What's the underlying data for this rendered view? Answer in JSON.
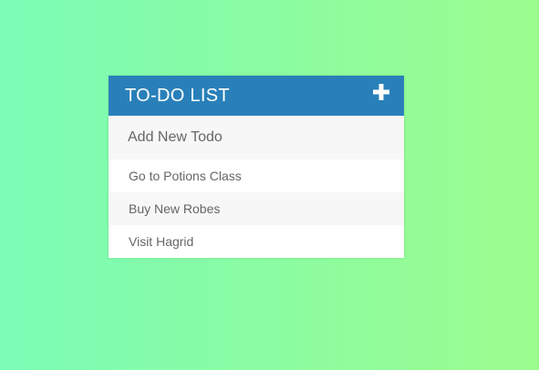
{
  "todo": {
    "title": "TO-DO LIST",
    "add_icon": "plus-icon",
    "input": {
      "placeholder": "Add New Todo",
      "value": ""
    },
    "items": [
      {
        "label": "Go to Potions Class"
      },
      {
        "label": "Buy New Robes"
      },
      {
        "label": "Visit Hagrid"
      }
    ]
  },
  "colors": {
    "header_bg": "#2980b9",
    "background_gradient_start": "#7bfcb7",
    "background_gradient_end": "#9bfc8d"
  }
}
